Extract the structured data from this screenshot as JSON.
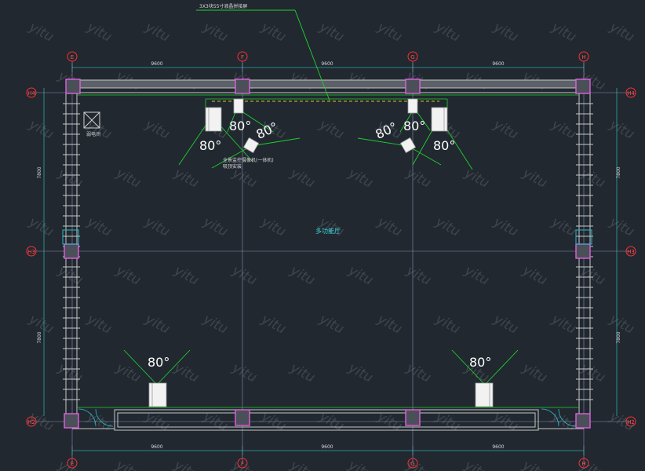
{
  "title_note": "3X3块55寸液晶拼接屏",
  "room_label": "多功能厅",
  "small_label": "弱电间",
  "cam_note_line1": "全景监控摄像机(一体机)",
  "cam_note_line2": "吸顶安装",
  "grid_columns": [
    "E",
    "F",
    "G",
    "H"
  ],
  "grid_rows": [
    "H4",
    "H3",
    "H2"
  ],
  "dim_top": [
    "9600",
    "9600",
    "9600"
  ],
  "dim_bottom": [
    "9600",
    "9600",
    "9600"
  ],
  "dim_side": [
    "7800",
    "7800"
  ],
  "angle_labels": [
    "80°",
    "80°",
    "80°",
    "80°",
    "80°",
    "80°",
    "80°",
    "80°"
  ],
  "watermark": "yitu",
  "colors": {
    "background": "#212830",
    "wall": "#c8c8c8",
    "column": "#e060e0",
    "angle_lines": "#1fd12c",
    "axis_bubble": "#ff3030",
    "dimension": "#2aa8a8",
    "room_label": "#3fd6dc"
  }
}
